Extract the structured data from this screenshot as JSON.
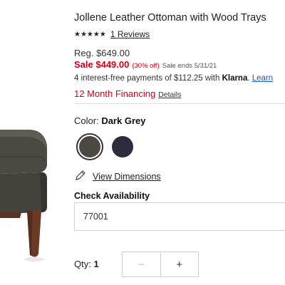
{
  "product": {
    "title": "Jollene Leather Ottoman with Wood Trays",
    "stars": "★★★★★",
    "reviews_label": "1 Reviews"
  },
  "pricing": {
    "regular": "Reg. $649.00",
    "sale": "Sale $449.00",
    "discount": "(30% off)",
    "sale_ends": "Sale ends 5/31/21"
  },
  "klarna": {
    "text": "4 interest-free payments of $112.25 with",
    "brand": "Klarna",
    "learn_label": "Learn"
  },
  "financing": {
    "label": "12 Month Financing",
    "details_label": "Details"
  },
  "color": {
    "prefix": "Color:",
    "selected": "Dark Grey",
    "swatches": [
      {
        "name": "Dark Grey",
        "hex": "#4b4a42",
        "selected": true
      },
      {
        "name": "Navy",
        "hex": "#2b2d3c",
        "selected": false
      }
    ]
  },
  "dimensions": {
    "icon": "pencil-icon",
    "label": "View Dimensions"
  },
  "availability": {
    "label": "Check Availability",
    "zip_value": "77001"
  },
  "quantity": {
    "label": "Qty:",
    "value": "1",
    "minus": "−",
    "plus": "+"
  },
  "colors": {
    "sale_red": "#d50019",
    "link_blue": "#1a5bb5"
  }
}
